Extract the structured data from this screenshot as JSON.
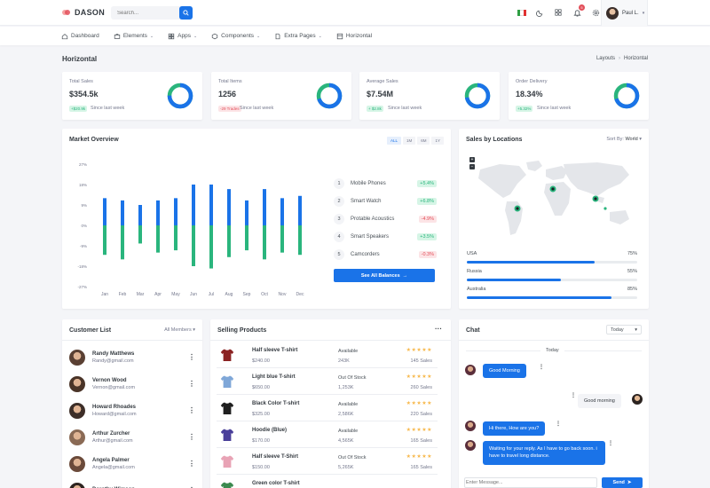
{
  "header": {
    "brand": "DASON",
    "search_placeholder": "Search...",
    "notif_count": "5",
    "user_name": "Paul L."
  },
  "nav": {
    "items": [
      {
        "label": "Dashboard",
        "icon": "home-icon",
        "has_caret": false
      },
      {
        "label": "Elements",
        "icon": "briefcase-icon",
        "has_caret": true
      },
      {
        "label": "Apps",
        "icon": "grid-icon",
        "has_caret": true
      },
      {
        "label": "Components",
        "icon": "box-icon",
        "has_caret": true
      },
      {
        "label": "Extra Pages",
        "icon": "file-icon",
        "has_caret": true
      },
      {
        "label": "Horizontal",
        "icon": "layout-icon",
        "has_caret": false
      }
    ]
  },
  "page": {
    "title": "Horizontal",
    "breadcrumb": [
      "Layouts",
      "Horizontal"
    ]
  },
  "stats": [
    {
      "label": "Total Sales",
      "value": "$354.5k",
      "badge": "+$20.9k",
      "trend": "up",
      "since": "Since last week",
      "percent": 0.75
    },
    {
      "label": "Total Items",
      "value": "1256",
      "badge": "-29 Trades",
      "trend": "down",
      "since": "Since last week",
      "percent": 0.7
    },
    {
      "label": "Average Sales",
      "value": "$7.54M",
      "badge": "+ $2.8k",
      "trend": "up",
      "since": "Since last week",
      "percent": 0.72
    },
    {
      "label": "Order Delivery",
      "value": "18.34%",
      "badge": "+5.32%",
      "trend": "up",
      "since": "Since last week",
      "percent": 0.7
    }
  ],
  "market_overview": {
    "title": "Market Overview",
    "ranges": [
      "ALL",
      "1M",
      "6M",
      "1Y"
    ],
    "active_range": "ALL",
    "items": [
      {
        "rank": "1",
        "name": "Mobile Phones",
        "change": "+5.4%",
        "trend": "up"
      },
      {
        "rank": "2",
        "name": "Smart Watch",
        "change": "+6.8%",
        "trend": "up"
      },
      {
        "rank": "3",
        "name": "Protable Acoustics",
        "change": "-4.9%",
        "trend": "down"
      },
      {
        "rank": "4",
        "name": "Smart Speakers",
        "change": "+3.5%",
        "trend": "up"
      },
      {
        "rank": "5",
        "name": "Camcorders",
        "change": "-0.3%",
        "trend": "down"
      }
    ],
    "button": "See All Balances"
  },
  "chart_data": {
    "type": "bar",
    "categories": [
      "Jan",
      "Feb",
      "Mar",
      "Apr",
      "May",
      "Jun",
      "Jul",
      "Aug",
      "Sep",
      "Oct",
      "Nov",
      "Dec"
    ],
    "y_ticks": [
      "27%",
      "18%",
      "9%",
      "0%",
      "-9%",
      "-18%",
      "-27%"
    ],
    "ylim": [
      -27,
      27
    ],
    "series": [
      {
        "color": "#1a73e8",
        "values": [
          12,
          11,
          9,
          11,
          12,
          18,
          18,
          16,
          11,
          16,
          12,
          13
        ]
      },
      {
        "color": "#2ab57d",
        "values": [
          -13,
          -15,
          -8,
          -12,
          -11,
          -18,
          -19,
          -14,
          -11,
          -15,
          -12,
          -13
        ]
      }
    ],
    "grid": false
  },
  "sales_locations": {
    "title": "Sales by Locations",
    "sort_label": "Sort By:",
    "sort_value": "World",
    "rows": [
      {
        "country": "USA",
        "percent_text": "75%",
        "value": 0.75
      },
      {
        "country": "Russia",
        "percent_text": "55%",
        "value": 0.55
      },
      {
        "country": "Australia",
        "percent_text": "85%",
        "value": 0.85
      }
    ]
  },
  "customers": {
    "title": "Customer List",
    "filter": "All Members",
    "rows": [
      {
        "name": "Randy Matthews",
        "email": "Randy@gmail.com"
      },
      {
        "name": "Vernon Wood",
        "email": "Vernon@gmail.com"
      },
      {
        "name": "Howard Rhoades",
        "email": "Howard@gmail.com"
      },
      {
        "name": "Arthur Zurcher",
        "email": "Arthur@gmail.com"
      },
      {
        "name": "Angela Palmer",
        "email": "Angela@gmail.com"
      },
      {
        "name": "Dorothy Wimson",
        "email": ""
      }
    ]
  },
  "products": {
    "title": "Selling Products",
    "rows": [
      {
        "name": "Half sleeve T-shirt",
        "price": "$240.00",
        "status": "Available",
        "qty": "243K",
        "reviews": "145 Sales",
        "color": "#8b2323"
      },
      {
        "name": "Light blue T-shirt",
        "price": "$650.00",
        "status": "Out Of Stock",
        "qty": "1,253K",
        "reviews": "260 Sales",
        "color": "#7fa7d8"
      },
      {
        "name": "Black Color T-shirt",
        "price": "$325.00",
        "status": "Available",
        "qty": "2,586K",
        "reviews": "220 Sales",
        "color": "#1f1f1f"
      },
      {
        "name": "Hoodie (Blue)",
        "price": "$170.00",
        "status": "Available",
        "qty": "4,565K",
        "reviews": "165 Sales",
        "color": "#4a3f9a"
      },
      {
        "name": "Half sleeve T-Shirt",
        "price": "$150.00",
        "status": "Out Of Stock",
        "qty": "5,265K",
        "reviews": "165 Sales",
        "color": "#e8a3b5"
      },
      {
        "name": "Green color T-shirt",
        "price": "",
        "status": "",
        "qty": "",
        "reviews": "",
        "color": "#3b8a4f"
      }
    ]
  },
  "chat": {
    "title": "Chat",
    "filter": "Today",
    "day_label": "Today",
    "messages": [
      {
        "text": "Good Morning",
        "dir": "in"
      },
      {
        "text": "Good morning",
        "dir": "out"
      },
      {
        "text": "Hi there, How are you?",
        "dir": "in"
      },
      {
        "text": "Waiting for your reply. As I have to go back soon. i have to travel long distance.",
        "dir": "in"
      }
    ],
    "input_placeholder": "Enter Message...",
    "send_label": "Send"
  }
}
